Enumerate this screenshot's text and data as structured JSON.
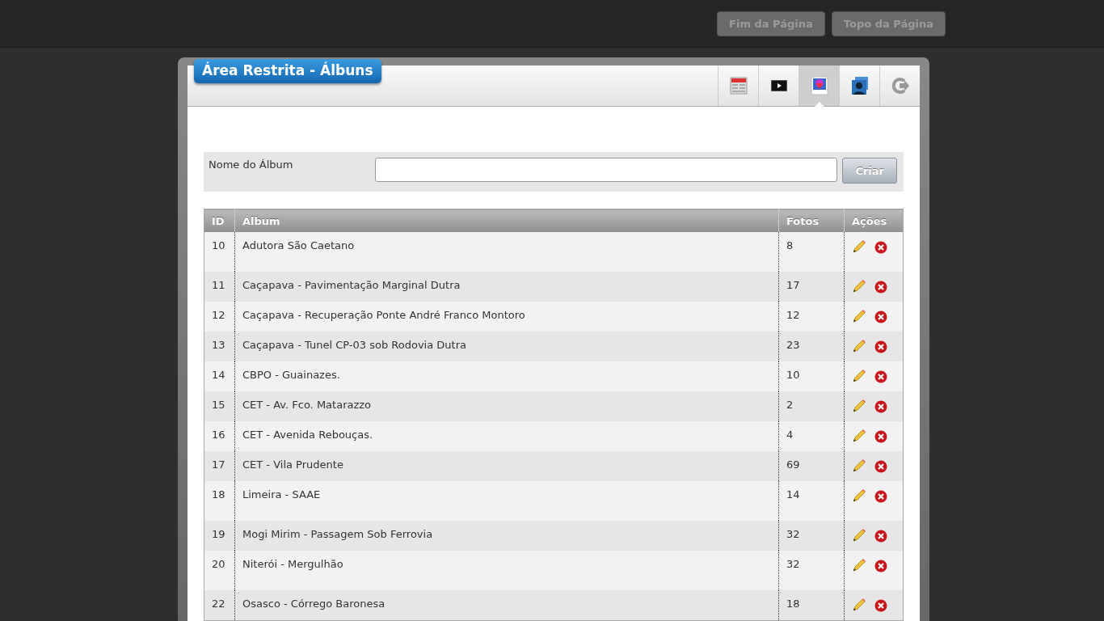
{
  "top_buttons": [
    "Fim da Página",
    "Topo da Página"
  ],
  "panel": {
    "title": "Área Restrita - Álbuns",
    "toolbar": [
      {
        "kind": "news",
        "selected": false
      },
      {
        "kind": "video",
        "selected": false
      },
      {
        "kind": "photo",
        "selected": true
      },
      {
        "kind": "users",
        "selected": false
      },
      {
        "kind": "logout",
        "selected": false
      }
    ]
  },
  "form": {
    "label": "Nome do Álbum",
    "button": "Criar"
  },
  "table": {
    "columns": [
      "ID",
      "Álbum",
      "Fotos",
      "Ações"
    ],
    "rows": [
      {
        "id": "10",
        "album": "Adutora São Caetano",
        "fotos": "8",
        "tall": true
      },
      {
        "id": "11",
        "album": "Caçapava - Pavimentação Marginal Dutra",
        "fotos": "17",
        "tall": false
      },
      {
        "id": "12",
        "album": "Caçapava - Recuperação Ponte André Franco Montoro",
        "fotos": "12",
        "tall": false
      },
      {
        "id": "13",
        "album": "Caçapava - Tunel CP-03 sob Rodovia Dutra",
        "fotos": "23",
        "tall": false
      },
      {
        "id": "14",
        "album": "CBPO - Guainazes.",
        "fotos": "10",
        "tall": false
      },
      {
        "id": "15",
        "album": "CET - Av. Fco. Matarazzo",
        "fotos": "2",
        "tall": false
      },
      {
        "id": "16",
        "album": "CET - Avenida Rebouças.",
        "fotos": "4",
        "tall": false
      },
      {
        "id": "17",
        "album": "CET - Vila Prudente",
        "fotos": "69",
        "tall": false
      },
      {
        "id": "18",
        "album": "Limeira - SAAE",
        "fotos": "14",
        "tall": true
      },
      {
        "id": "19",
        "album": "Mogi Mirim - Passagem Sob Ferrovia",
        "fotos": "32",
        "tall": false
      },
      {
        "id": "20",
        "album": "Niterói - Mergulhão",
        "fotos": "32",
        "tall": true
      },
      {
        "id": "22",
        "album": "Osasco - Córrego Baronesa",
        "fotos": "18",
        "tall": false
      }
    ]
  }
}
